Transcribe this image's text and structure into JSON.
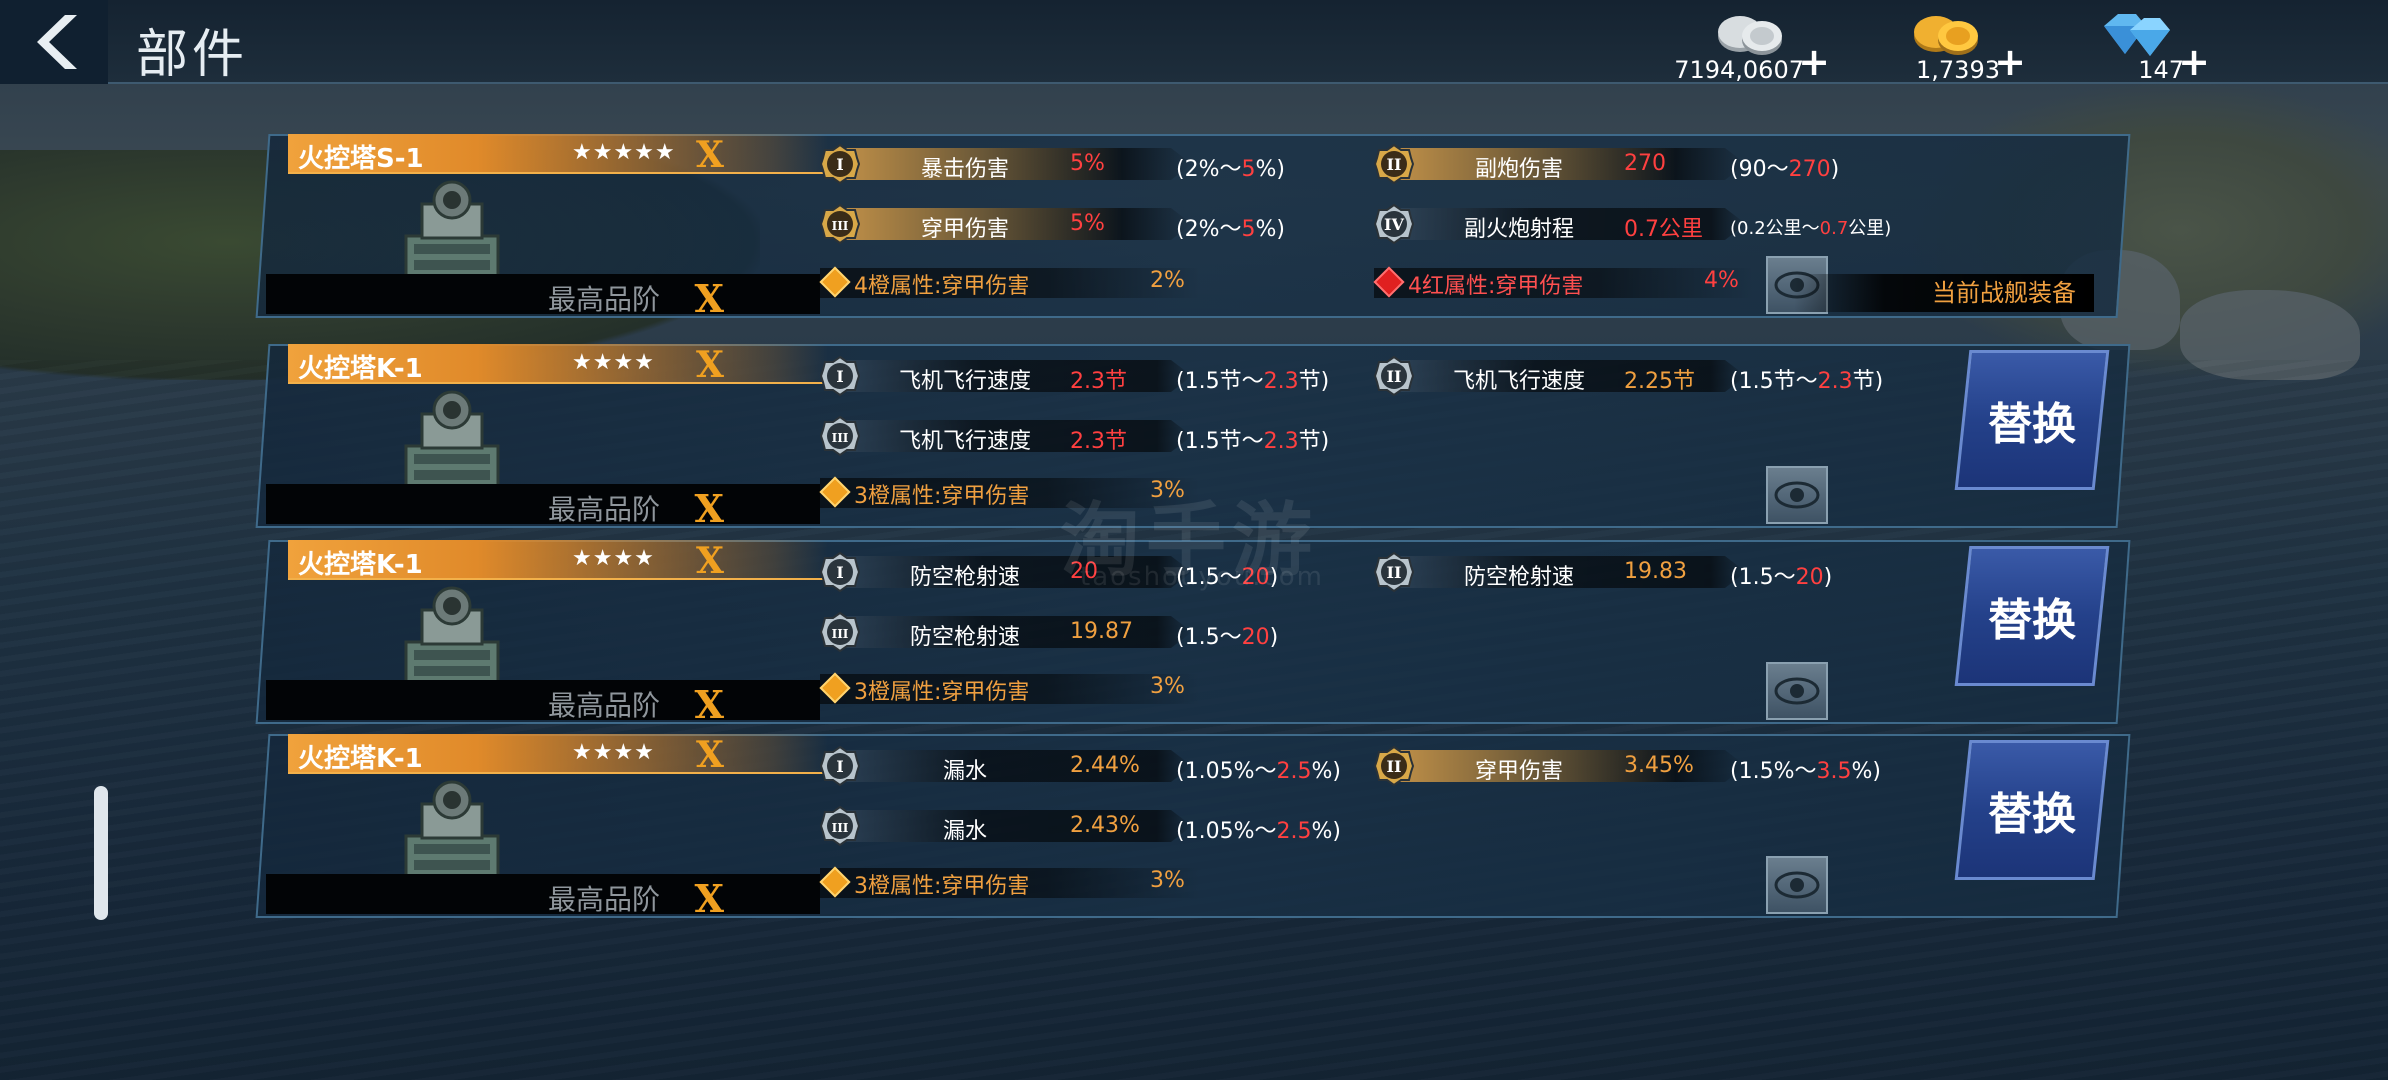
{
  "header": {
    "title": "部件",
    "currencies": [
      {
        "icon": "silver-coins-icon",
        "value": "7194,0607"
      },
      {
        "icon": "gold-coins-icon",
        "value": "1,7393"
      },
      {
        "icon": "diamond-icon",
        "value": "147"
      }
    ],
    "plus": "+"
  },
  "watermark": {
    "main": "淘手游",
    "sub": "taoshouyou.com"
  },
  "cards": [
    {
      "name": "火控塔S-1",
      "stars": "★★★★★",
      "grade": "X",
      "quality_label": "最高品阶",
      "quality_grade": "X",
      "equipped": "当前战舰装备",
      "stats": [
        {
          "numeral": "I",
          "name": "暴击伤害",
          "value": "5%",
          "range_pre": "(2%～",
          "range_max": "5",
          "range_post": "%)",
          "gold": true
        },
        {
          "numeral": "II",
          "name": "副炮伤害",
          "value": "270",
          "range_pre": "(90～",
          "range_max": "270",
          "range_post": ")",
          "gold": true
        },
        {
          "numeral": "III",
          "name": "穿甲伤害",
          "value": "5%",
          "range_pre": "(2%～",
          "range_max": "5",
          "range_post": "%)",
          "gold": true
        },
        {
          "numeral": "IV",
          "name": "副火炮射程",
          "value": "0.7公里",
          "range_pre": "(0.2公里～",
          "range_max": "0.7",
          "range_post": "公里)",
          "gold": false
        }
      ],
      "attrs": [
        {
          "name": "4橙属性:穿甲伤害",
          "value": "2%",
          "color": "orange"
        },
        {
          "name": "4红属性:穿甲伤害",
          "value": "4%",
          "color": "red"
        }
      ]
    },
    {
      "name": "火控塔K-1",
      "stars": "★★★★",
      "grade": "X",
      "quality_label": "最高品阶",
      "quality_grade": "X",
      "replace": "替换",
      "stats": [
        {
          "numeral": "I",
          "name": "飞机飞行速度",
          "value": "2.3节",
          "range_pre": "(1.5节～",
          "range_max": "2.3",
          "range_post": "节)",
          "gold": false
        },
        {
          "numeral": "II",
          "name": "飞机飞行速度",
          "value": "2.25节",
          "range_pre": "(1.5节～",
          "range_max": "2.3",
          "range_post": "节)",
          "gold": false,
          "orange": true
        },
        {
          "numeral": "III",
          "name": "飞机飞行速度",
          "value": "2.3节",
          "range_pre": "(1.5节～",
          "range_max": "2.3",
          "range_post": "节)",
          "gold": false
        }
      ],
      "attrs": [
        {
          "name": "3橙属性:穿甲伤害",
          "value": "3%",
          "color": "orange"
        }
      ]
    },
    {
      "name": "火控塔K-1",
      "stars": "★★★★",
      "grade": "X",
      "quality_label": "最高品阶",
      "quality_grade": "X",
      "replace": "替换",
      "stats": [
        {
          "numeral": "I",
          "name": "防空枪射速",
          "value": "20",
          "range_pre": "(1.5～",
          "range_max": "20",
          "range_post": ")",
          "gold": false
        },
        {
          "numeral": "II",
          "name": "防空枪射速",
          "value": "19.83",
          "range_pre": "(1.5～",
          "range_max": "20",
          "range_post": ")",
          "gold": false,
          "orange": true
        },
        {
          "numeral": "III",
          "name": "防空枪射速",
          "value": "19.87",
          "range_pre": "(1.5～",
          "range_max": "20",
          "range_post": ")",
          "gold": false,
          "orange": true
        }
      ],
      "attrs": [
        {
          "name": "3橙属性:穿甲伤害",
          "value": "3%",
          "color": "orange"
        }
      ]
    },
    {
      "name": "火控塔K-1",
      "stars": "★★★★",
      "grade": "X",
      "quality_label": "最高品阶",
      "quality_grade": "X",
      "replace": "替换",
      "stats": [
        {
          "numeral": "I",
          "name": "漏水",
          "value": "2.44%",
          "range_pre": "(1.05%～",
          "range_max": "2.5",
          "range_post": "%)",
          "gold": false,
          "orange": true
        },
        {
          "numeral": "II",
          "name": "穿甲伤害",
          "value": "3.45%",
          "range_pre": "(1.5%～",
          "range_max": "3.5",
          "range_post": "%)",
          "gold": true,
          "orange": true
        },
        {
          "numeral": "III",
          "name": "漏水",
          "value": "2.43%",
          "range_pre": "(1.05%～",
          "range_max": "2.5",
          "range_post": "%)",
          "gold": false,
          "orange": true
        }
      ],
      "attrs": [
        {
          "name": "3橙属性:穿甲伤害",
          "value": "3%",
          "color": "orange"
        }
      ]
    }
  ]
}
